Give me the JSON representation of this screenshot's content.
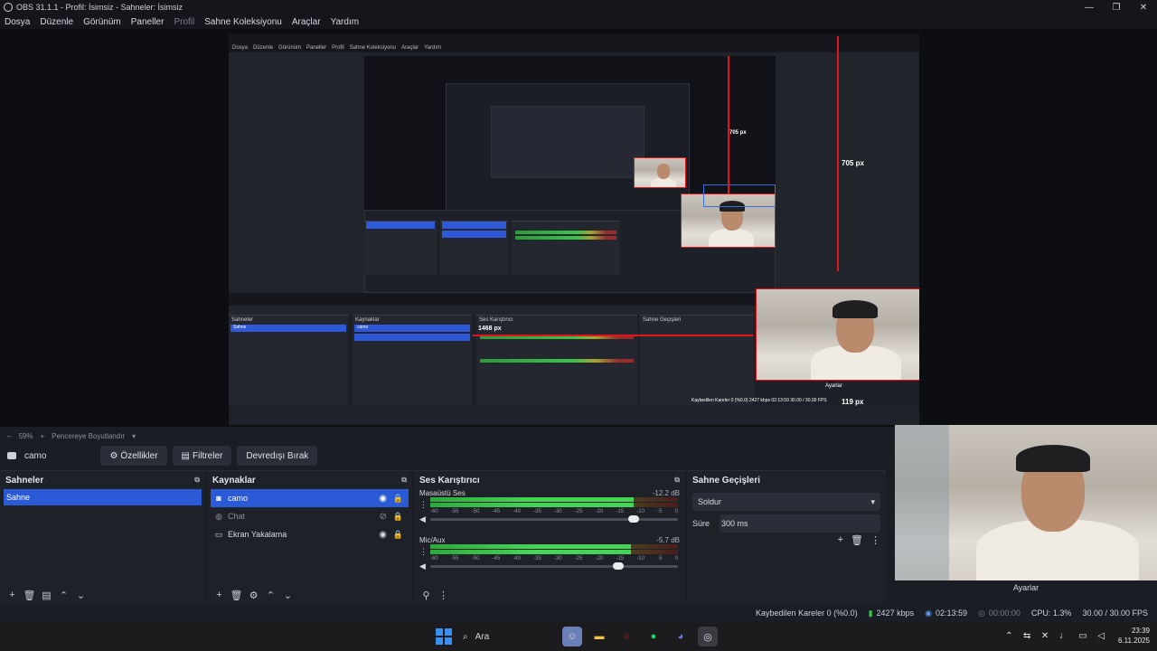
{
  "window": {
    "title": "OBS 31.1.1 - Profil: İsimsiz - Sahneler: İsimsiz",
    "controls": [
      "—",
      "❐",
      "✕"
    ]
  },
  "menu": [
    "Dosya",
    "Düzenle",
    "Görünüm",
    "Paneller",
    "Profil",
    "Sahne Koleksiyonu",
    "Araçlar",
    "Yardım"
  ],
  "preview": {
    "measure_right": "705 px",
    "measure_inner": "705 px",
    "measure_bottom": "119 px",
    "measure_left": "1468 px",
    "inner_cam_label": "Ayarlar",
    "inner_status": "Kaybedilen Kareler 0 (%0.0)   2427 kbps   02:13:59   30.00 / 30.00 FPS"
  },
  "zoom": {
    "level": "59%",
    "resize": "Pencereye Boyutlandır"
  },
  "source_bar": {
    "selected_source": "camo",
    "properties": "Özellikler",
    "filters": "Filtreler",
    "deactivate": "Devredışı Bırak"
  },
  "scenes": {
    "title": "Sahneler",
    "items": [
      "Sahne"
    ]
  },
  "sources": {
    "title": "Kaynaklar",
    "items": [
      {
        "name": "camo",
        "icon": "camera-icon",
        "visible": true
      },
      {
        "name": "Chat",
        "icon": "browser-icon",
        "visible": false
      },
      {
        "name": "Ekran Yakalama",
        "icon": "monitor-icon",
        "visible": true
      }
    ]
  },
  "mixer": {
    "title": "Ses Karıştırıcı",
    "ticks": [
      "-60",
      "-55",
      "-50",
      "-45",
      "-40",
      "-35",
      "-30",
      "-25",
      "-20",
      "-15",
      "-10",
      "-5",
      "0"
    ],
    "channels": [
      {
        "name": "Masaüstü Ses",
        "db": "-12.2 dB",
        "level": 0.82,
        "fader": 0.82
      },
      {
        "name": "Mic/Aux",
        "db": "-5.7 dB",
        "level": 0.81,
        "fader": 0.76
      }
    ]
  },
  "transitions": {
    "title": "Sahne Geçişleri",
    "selected": "Soldur",
    "duration_label": "Süre",
    "duration_value": "300 ms"
  },
  "camera": {
    "label": "Ayarlar"
  },
  "status": {
    "dropped": "Kaybedilen Kareler 0 (%0.0)",
    "bitrate": "2427 kbps",
    "stream_time": "02:13:59",
    "rec_time": "00:00:00",
    "cpu": "CPU: 1.3%",
    "fps": "30.00 / 30.00 FPS"
  },
  "taskbar": {
    "search": "Ara",
    "time": "23:39",
    "date": "6.11.2025"
  },
  "colors": {
    "accent": "#2a5ad6",
    "red_guides": "#e0161d",
    "meter_green": "#45d456"
  }
}
